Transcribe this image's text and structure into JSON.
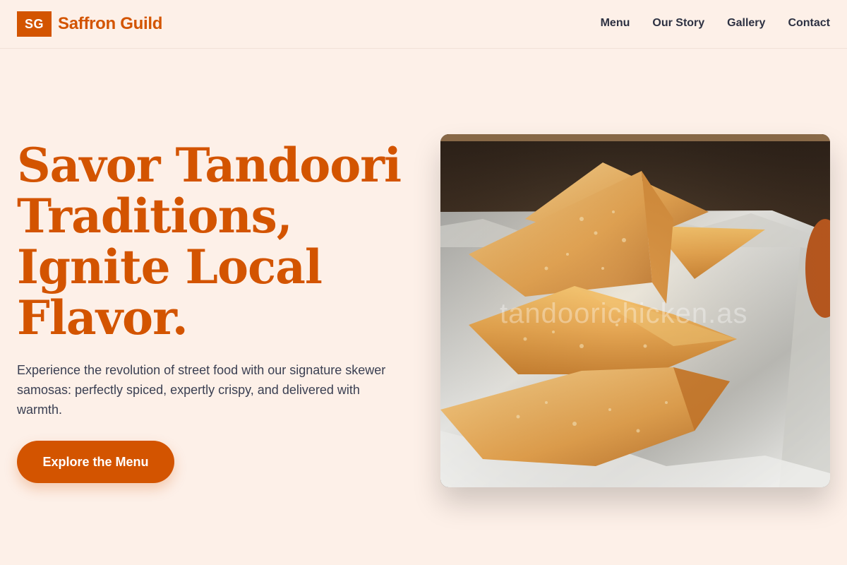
{
  "brand": {
    "logo_mark": "SG",
    "name": "Saffron Guild",
    "accent_color": "#d35400"
  },
  "nav": {
    "items": [
      {
        "label": "Menu"
      },
      {
        "label": "Our Story"
      },
      {
        "label": "Gallery"
      },
      {
        "label": "Contact"
      }
    ]
  },
  "hero": {
    "title_lines": [
      "Savor Tandoori",
      "Traditions,",
      "Ignite Local",
      "Flavor."
    ],
    "subtitle": "Experience the revolution of street food with our signature skewer samosas: perfectly spiced, expertly crispy, and delivered with warmth.",
    "cta_label": "Explore the Menu",
    "image_watermark": "tandoorichicken.as"
  }
}
